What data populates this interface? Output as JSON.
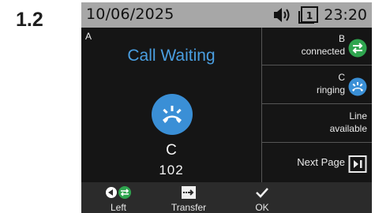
{
  "step_label": "1.2",
  "status_bar": {
    "date": "10/06/2025",
    "time": "23:20",
    "speaker_icon": "speaker-volume-icon",
    "line_icon": "line-1-icon",
    "line_number": "1"
  },
  "call": {
    "line": "A",
    "title": "Call Waiting",
    "caller_name": "C",
    "caller_number": "102",
    "icon": "incoming-call-icon",
    "icon_color": "#3a8fd6"
  },
  "side_panel": {
    "items": [
      {
        "line": "B",
        "status": "connected",
        "icon": "connected-call-icon",
        "icon_color": "#2fa54f"
      },
      {
        "line": "C",
        "status": "ringing",
        "icon": "ringing-call-icon",
        "icon_color": "#3a8fd6"
      },
      {
        "line": "Line",
        "status": "available"
      }
    ],
    "next_page": {
      "label": "Next Page",
      "icon": "next-page-icon"
    }
  },
  "softkeys": [
    {
      "label": "Left",
      "icon": "left-swap-icon"
    },
    {
      "label": "Transfer",
      "icon": "transfer-icon"
    },
    {
      "label": "OK",
      "icon": "checkmark-icon"
    }
  ],
  "colors": {
    "title_blue": "#4a9ee0",
    "status_bar": "#a7a7a7",
    "background": "#151515"
  }
}
